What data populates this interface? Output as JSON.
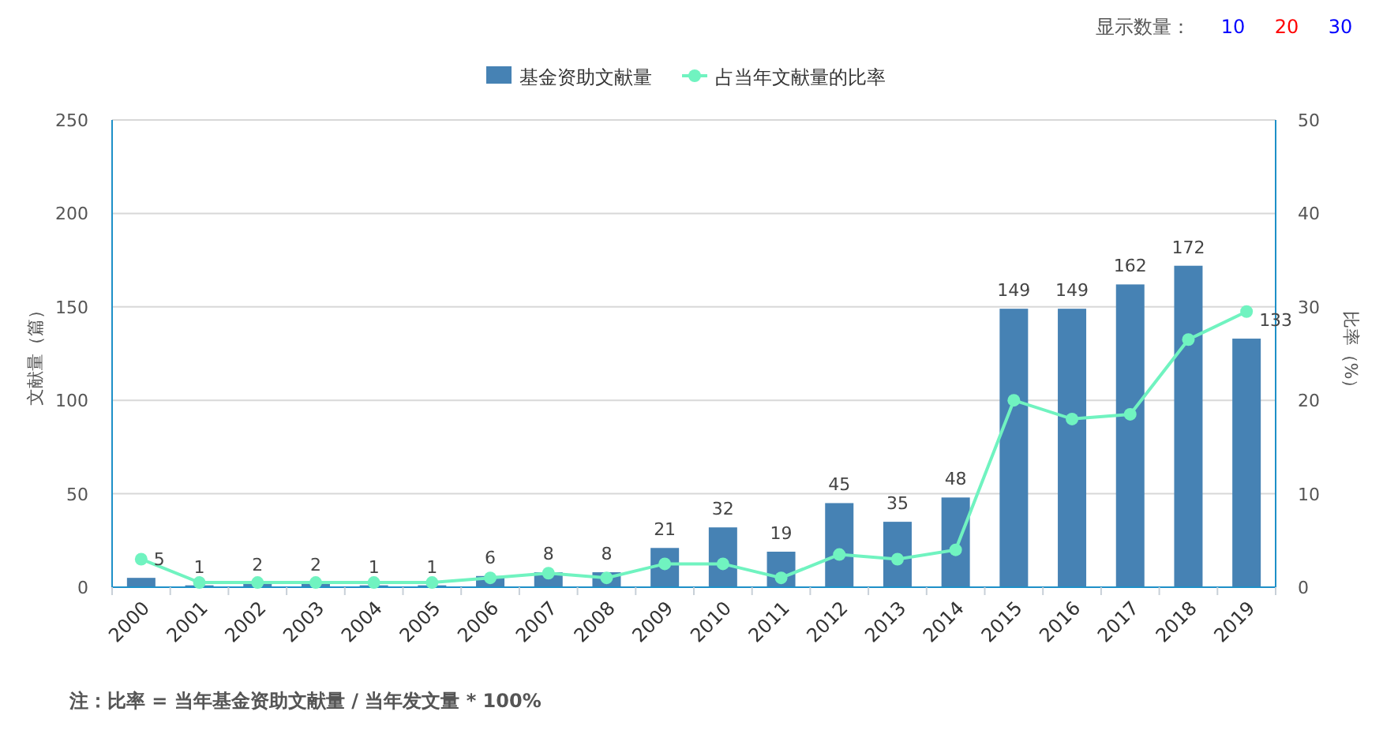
{
  "display_count": {
    "label": "显示数量：",
    "options": [
      {
        "label": "10",
        "color": "#0000ff"
      },
      {
        "label": "20",
        "color": "#ff0000"
      },
      {
        "label": "30",
        "color": "#0000ff"
      }
    ]
  },
  "chart": {
    "chart_data": {
      "type": "bar",
      "ylabel": "文献量（篇）",
      "y2label": "比率（%）",
      "categories": [
        "2000",
        "2001",
        "2002",
        "2003",
        "2004",
        "2005",
        "2006",
        "2007",
        "2008",
        "2009",
        "2010",
        "2011",
        "2012",
        "2013",
        "2014",
        "2015",
        "2016",
        "2017",
        "2018",
        "2019"
      ],
      "ylim": [
        0,
        250
      ],
      "yticks": [
        0,
        50,
        100,
        150,
        200,
        250
      ],
      "y2lim": [
        0,
        50
      ],
      "y2ticks": [
        0,
        10,
        20,
        30,
        40,
        50
      ],
      "grid": true,
      "legend": "top",
      "series": [
        {
          "name": "基金资助文献量",
          "color": "#4682b4",
          "values": [
            5,
            1,
            2,
            2,
            1,
            1,
            6,
            8,
            8,
            21,
            32,
            19,
            45,
            35,
            48,
            149,
            149,
            162,
            172,
            133
          ],
          "data_labels": true
        },
        {
          "name": "占当年文献量的比率",
          "type": "line",
          "axis": "y2",
          "marker": "circle",
          "color": "#70f3c0",
          "values": [
            3,
            0.5,
            0.5,
            0.5,
            0.5,
            0.5,
            1,
            1.5,
            1,
            2.5,
            2.5,
            1,
            3.5,
            3,
            4,
            20,
            18,
            18.5,
            26.5,
            29.5
          ]
        }
      ]
    }
  },
  "note": "**注：比率 = 当年基金资助文献量 / 当年发文量 * 100%**"
}
